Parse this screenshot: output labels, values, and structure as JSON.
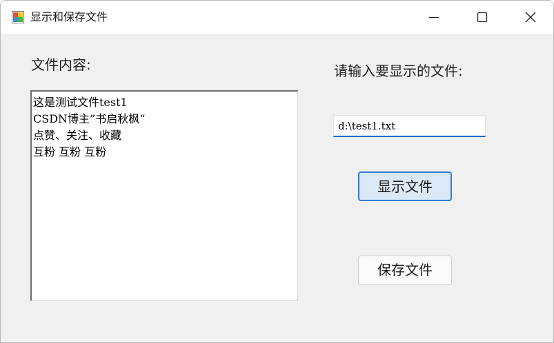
{
  "window": {
    "title": "显示和保存文件",
    "icon": "winforms-app-icon"
  },
  "caption_buttons": {
    "minimize": "minimize-icon",
    "maximize": "maximize-icon",
    "close": "close-icon"
  },
  "labels": {
    "file_content": "文件内容:",
    "input_prompt": "请输入要显示的文件:"
  },
  "content_box": {
    "lines": [
      "这是测试文件test1",
      "CSDN博主”书启秋枫“",
      "点赞、关注、收藏",
      "互粉 互粉 互粉"
    ]
  },
  "path_input": {
    "value": "d:\\test1.txt"
  },
  "buttons": {
    "show_file": "显示文件",
    "save_file": "保存文件"
  },
  "colors": {
    "window_bg": "#f0f0f0",
    "accent": "#0a63c7",
    "focused_button_bg": "#dbe9f6"
  }
}
